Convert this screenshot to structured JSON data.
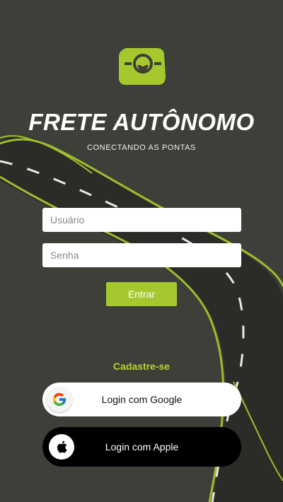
{
  "app": {
    "title": "FRETE AUTÔNOMO",
    "tagline": "CONECTANDO AS PONTAS",
    "logo_icon": "truck-pin-logo-icon"
  },
  "form": {
    "username_placeholder": "Usuário",
    "password_placeholder": "Senha",
    "submit_label": "Entrar"
  },
  "signup_label": "Cadastre-se",
  "social": {
    "google_label": "Login com Google",
    "google_icon": "google-icon",
    "apple_label": "Login com Apple",
    "apple_icon": "apple-icon"
  },
  "colors": {
    "background": "#3d3f38",
    "accent": "#a6c82f",
    "road": "#2a2b27",
    "road_edge": "#9dbd2c"
  }
}
